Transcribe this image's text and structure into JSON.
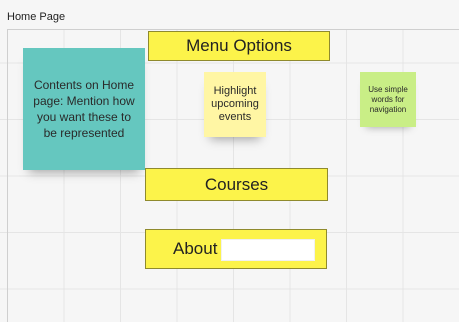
{
  "frame": {
    "title": "Home Page"
  },
  "boxes": {
    "menu_options": "Menu Options",
    "courses": "Courses",
    "about": "About"
  },
  "stickies": {
    "contents_note": "Contents on Home page: Mention how you want these to be represented",
    "highlight_note": "Highlight upcoming events",
    "simple_words_note": "Use simple words for navigation"
  },
  "colors": {
    "yellow_box": "#fcf34a",
    "teal_note": "#65c7bf",
    "light_yellow_note": "#fff6a4",
    "lime_note": "#c9ee86"
  }
}
